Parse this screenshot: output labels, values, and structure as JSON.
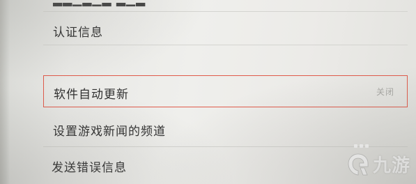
{
  "settings": {
    "items": [
      {
        "label": "认证信息"
      },
      {
        "label": "软件自动更新",
        "value": "关闭"
      },
      {
        "label": "设置游戏新闻的频道"
      },
      {
        "label": "发送错误信息"
      }
    ]
  },
  "watermark": {
    "text": "九游",
    "logo_icon": "jiuyou-logo-icon"
  },
  "colors": {
    "highlight_border": "#e05a4a",
    "text": "#2f2f2f",
    "value_text": "#a8a8a4"
  }
}
